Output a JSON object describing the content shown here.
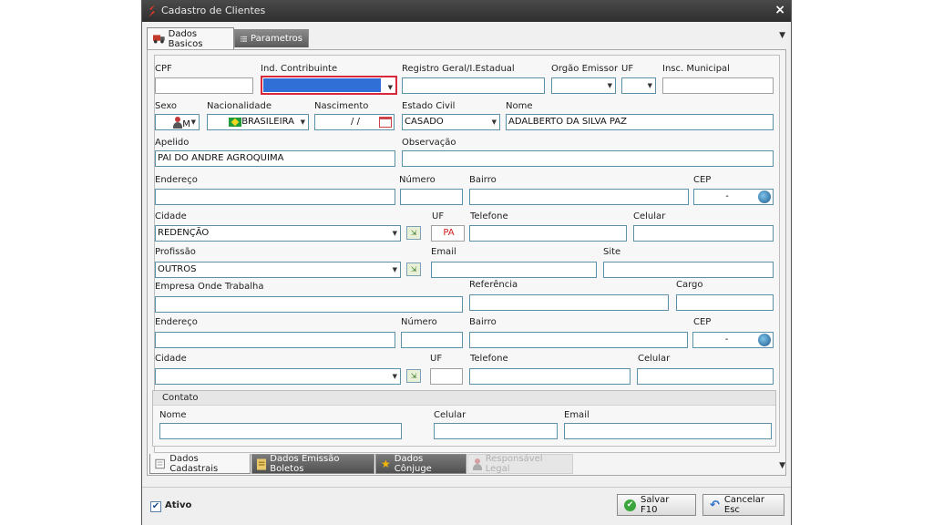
{
  "window": {
    "title": "Cadastro de Clientes",
    "close": "×"
  },
  "top_tabs": [
    {
      "label": "Dados Basicos"
    },
    {
      "label": "Parametros"
    }
  ],
  "menu_arrow": "▼",
  "form": {
    "cpf": {
      "label": "CPF",
      "value": ""
    },
    "ind_contribuinte": {
      "label": "Ind. Contribuinte",
      "value": ""
    },
    "registro_geral": {
      "label": "Registro Geral/I.Estadual",
      "value": ""
    },
    "orgao_emissor": {
      "label": "Orgão Emissor",
      "value": ""
    },
    "uf": {
      "label": "UF",
      "value": ""
    },
    "insc_municipal": {
      "label": "Insc. Municipal",
      "value": ""
    },
    "sexo": {
      "label": "Sexo",
      "value": "M"
    },
    "nacionalidade": {
      "label": "Nacionalidade",
      "value": "BRASILEIRA"
    },
    "nascimento": {
      "label": "Nascimento",
      "value": " / /"
    },
    "estado_civil": {
      "label": "Estado Civil",
      "value": "CASADO"
    },
    "nome": {
      "label": "Nome",
      "value": "ADALBERTO DA SILVA PAZ"
    },
    "apelido": {
      "label": "Apelido",
      "value": "PAI DO ANDRE AGROQUIMA"
    },
    "observacao": {
      "label": "Observação",
      "value": ""
    },
    "endereco": {
      "label": "Endereço",
      "value": ""
    },
    "numero": {
      "label": "Número",
      "value": ""
    },
    "bairro": {
      "label": "Bairro",
      "value": ""
    },
    "cep": {
      "label": "CEP",
      "value": "-"
    },
    "cidade": {
      "label": "Cidade",
      "value": "REDENÇÃO"
    },
    "cidade_uf": {
      "label": "UF",
      "value": "PA"
    },
    "telefone": {
      "label": "Telefone",
      "value": ""
    },
    "celular": {
      "label": "Celular",
      "value": ""
    },
    "profissao": {
      "label": "Profissão",
      "value": "OUTROS"
    },
    "email": {
      "label": "Email",
      "value": ""
    },
    "site": {
      "label": "Site",
      "value": ""
    },
    "empresa": {
      "label": "Empresa Onde Trabalha",
      "value": ""
    },
    "referencia": {
      "label": "Referência",
      "value": ""
    },
    "cargo": {
      "label": "Cargo",
      "value": ""
    },
    "emp_endereco": {
      "label": "Endereço",
      "value": ""
    },
    "emp_numero": {
      "label": "Número",
      "value": ""
    },
    "emp_bairro": {
      "label": "Bairro",
      "value": ""
    },
    "emp_cep": {
      "label": "CEP",
      "value": "-"
    },
    "emp_cidade": {
      "label": "Cidade",
      "value": ""
    },
    "emp_uf": {
      "label": "UF",
      "value": ""
    },
    "emp_telefone": {
      "label": "Telefone",
      "value": ""
    },
    "emp_celular": {
      "label": "Celular",
      "value": ""
    }
  },
  "contato": {
    "title": "Contato",
    "nome": {
      "label": "Nome",
      "value": ""
    },
    "celular": {
      "label": "Celular",
      "value": ""
    },
    "email": {
      "label": "Email",
      "value": ""
    }
  },
  "bottom_tabs": [
    {
      "label": "Dados Cadastrais",
      "state": "active"
    },
    {
      "label": "Dados Emissão Boletos",
      "state": "inactive"
    },
    {
      "label": "Dados Cônjuge",
      "state": "inactive"
    },
    {
      "label": "Responsável Legal",
      "state": "disabled"
    }
  ],
  "footer": {
    "ativo_label": "Ativo",
    "ativo_checked": "✔",
    "save_label": "Salvar F10",
    "cancel_label": "Cancelar Esc"
  },
  "colors": {
    "titlebar": "#3a3a3a",
    "field_border": "#5c8fa8",
    "focus_border": "#d9283c",
    "selection": "#2f6fd6",
    "uf_text": "#d11a1a"
  }
}
